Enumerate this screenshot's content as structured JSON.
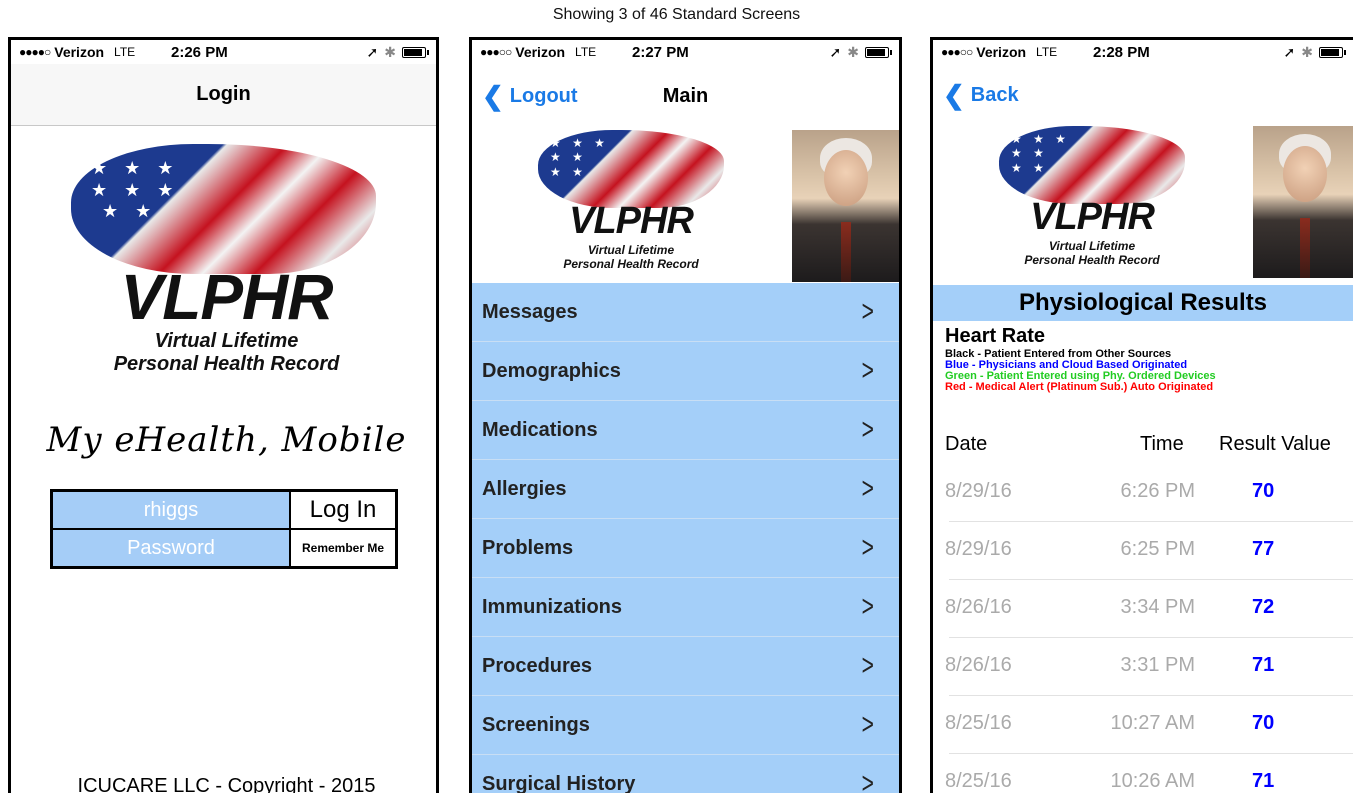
{
  "caption": "Showing 3 of 46 Standard Screens",
  "logo": {
    "brand": "VLPHR",
    "tagline_line1": "Virtual Lifetime",
    "tagline_line2": "Personal Health Record"
  },
  "screens": [
    {
      "status": {
        "dots": "●●●●○",
        "carrier": "Verizon",
        "network": "LTE",
        "time": "2:26 PM"
      },
      "title": "Login",
      "script_text": "My eHealth, Mobile",
      "username": "rhiggs",
      "password_placeholder": "Password",
      "login_label": "Log In",
      "remember_label": "Remember Me",
      "copyright": "ICUCARE LLC - Copyright - 2015"
    },
    {
      "status": {
        "dots": "●●●○○",
        "carrier": "Verizon",
        "network": "LTE",
        "time": "2:27 PM"
      },
      "back_label": "Logout",
      "title": "Main",
      "menu": [
        "Messages",
        "Demographics",
        "Medications",
        "Allergies",
        "Problems",
        "Immunizations",
        "Procedures",
        "Screenings",
        "Surgical History"
      ]
    },
    {
      "status": {
        "dots": "●●●○○",
        "carrier": "Verizon",
        "network": "LTE",
        "time": "2:28 PM"
      },
      "back_label": "Back",
      "section": "Physiological Results",
      "metric": "Heart Rate",
      "legend": [
        "Black - Patient Entered from Other Sources",
        "Blue - Physicians and Cloud Based Originated",
        "Green - Patient Entered using Phy. Ordered Devices",
        "Red - Medical Alert (Platinum Sub.) Auto Originated"
      ],
      "columns": [
        "Date",
        "Time",
        "Result Value"
      ],
      "rows": [
        {
          "date": "8/29/16",
          "time": "6:26 PM",
          "value": "70"
        },
        {
          "date": "8/29/16",
          "time": "6:25 PM",
          "value": "77"
        },
        {
          "date": "8/26/16",
          "time": "3:34 PM",
          "value": "72"
        },
        {
          "date": "8/26/16",
          "time": "3:31 PM",
          "value": "71"
        },
        {
          "date": "8/25/16",
          "time": "10:27 AM",
          "value": "70"
        },
        {
          "date": "8/25/16",
          "time": "10:26 AM",
          "value": "71"
        }
      ]
    }
  ]
}
